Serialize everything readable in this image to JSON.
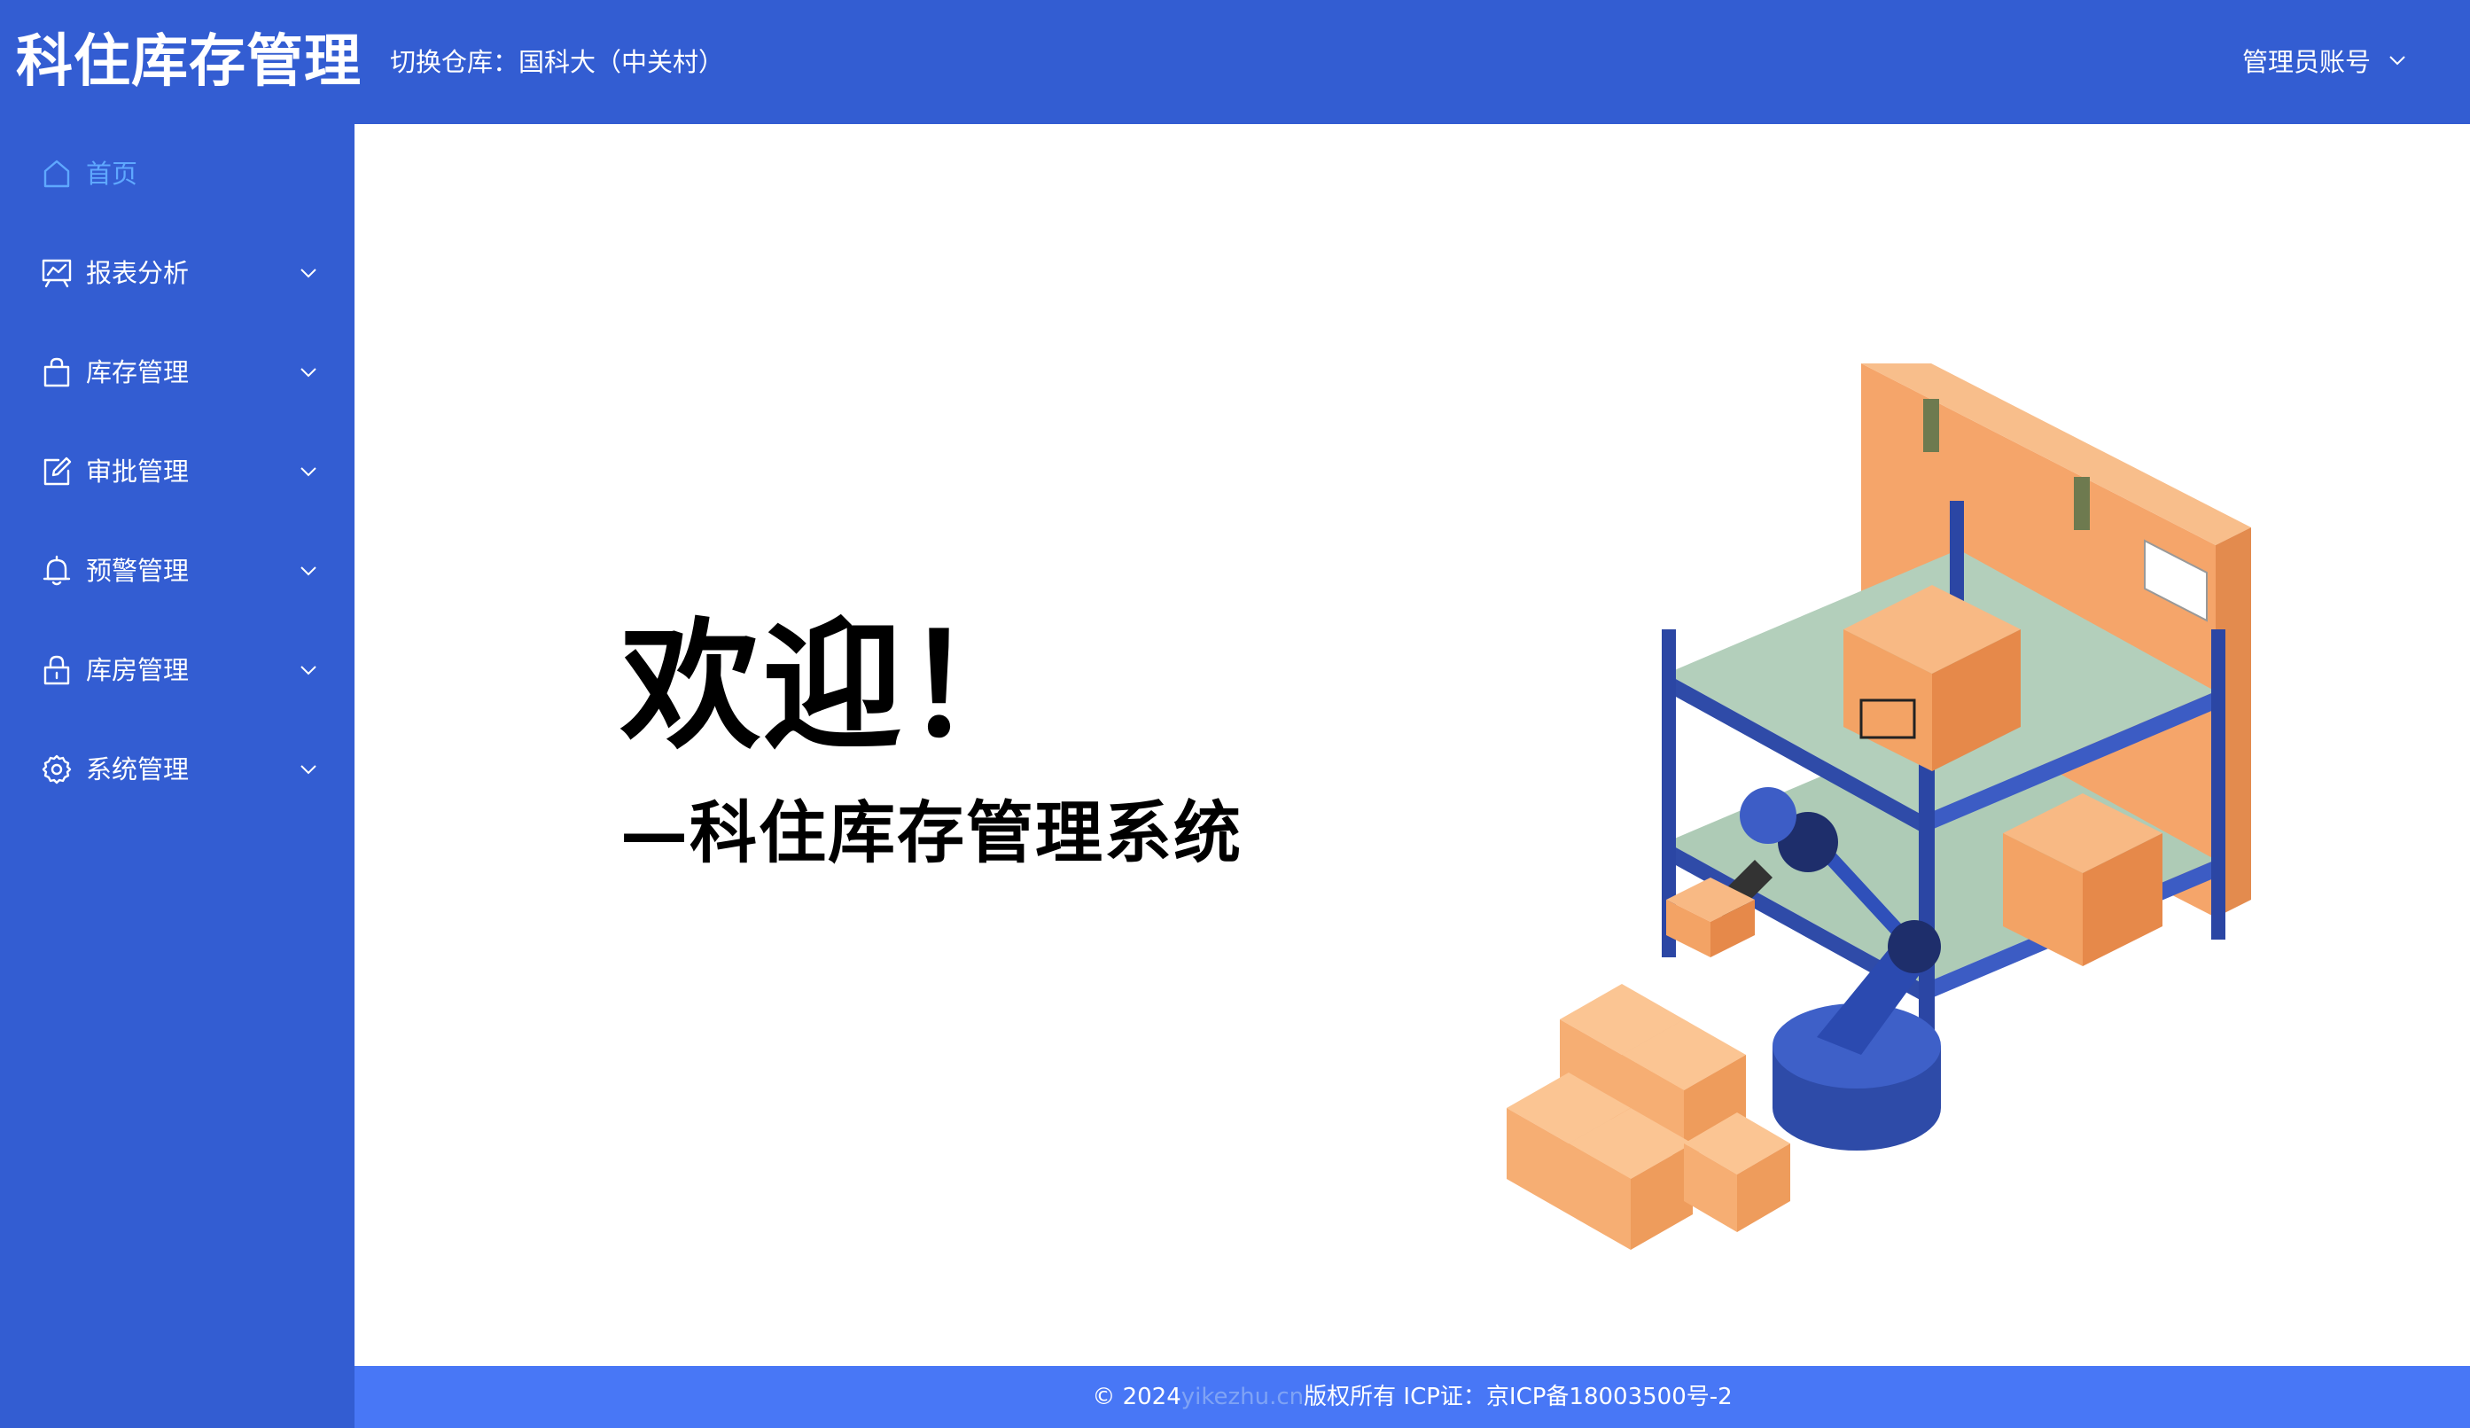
{
  "header": {
    "brand": "科住库存管理",
    "warehouse_switch": "切换仓库：国科大（中关村）",
    "account": "管理员账号"
  },
  "sidebar": {
    "items": [
      {
        "label": "首页",
        "icon": "home-icon",
        "active": true,
        "expandable": false
      },
      {
        "label": "报表分析",
        "icon": "chart-board-icon",
        "active": false,
        "expandable": true
      },
      {
        "label": "库存管理",
        "icon": "shopping-bag-icon",
        "active": false,
        "expandable": true
      },
      {
        "label": "审批管理",
        "icon": "edit-icon",
        "active": false,
        "expandable": true
      },
      {
        "label": "预警管理",
        "icon": "bell-icon",
        "active": false,
        "expandable": true
      },
      {
        "label": "库房管理",
        "icon": "lock-icon",
        "active": false,
        "expandable": true
      },
      {
        "label": "系统管理",
        "icon": "gear-icon",
        "active": false,
        "expandable": true
      }
    ]
  },
  "main": {
    "welcome": "欢迎！",
    "subtitle": "—科住库存管理系统"
  },
  "footer": {
    "copyright_prefix": "© 2024",
    "watermark": "yikezhu.cn",
    "copyright_suffix": "版权所有 ICP证：京ICP备18003500号-2"
  },
  "colors": {
    "sidebar_bg": "#335DD2",
    "footer_bg": "#4877F6",
    "active_item": "#5FA8FF"
  }
}
